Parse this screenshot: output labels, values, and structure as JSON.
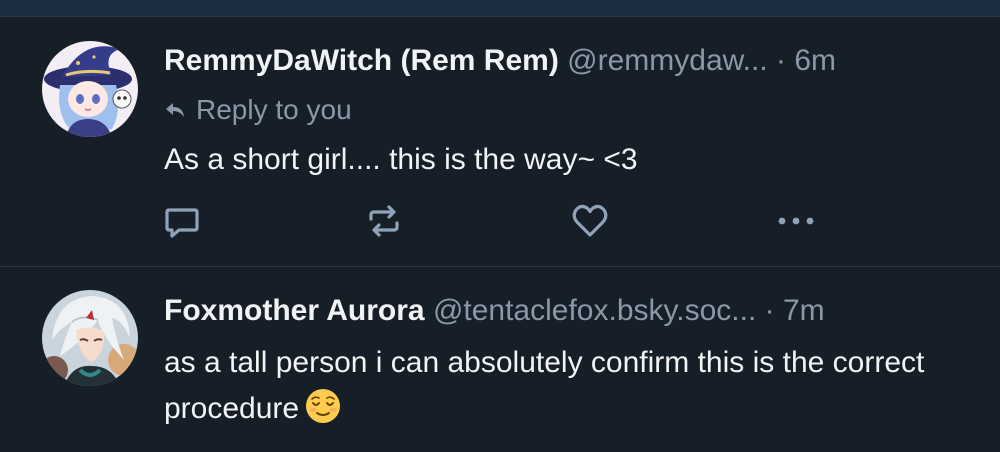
{
  "colors": {
    "background": "#161e27",
    "top_strip": "#1b2d40",
    "divider": "#2a3642",
    "text_primary": "#f1f3f5",
    "text_muted": "#8a98a8",
    "action_icon": "#8fa3b8"
  },
  "posts": [
    {
      "display_name": "RemmyDaWitch (Rem Rem)",
      "handle": "@remmydaw...",
      "separator": "·",
      "time": "6m",
      "reply_label": "Reply to you",
      "text": "As a short girl.... this is the way~ <3",
      "avatar_icon": "witch-avatar",
      "actions": [
        "reply-icon",
        "repost-icon",
        "like-icon",
        "more-icon"
      ]
    },
    {
      "display_name": "Foxmother Aurora",
      "handle": "@tentaclefox.bsky.soc...",
      "separator": "·",
      "time": "7m",
      "text": "as a tall person i can absolutely confirm this is the correct procedure",
      "emoji": "relieved-face-icon",
      "avatar_icon": "white-haired-character-avatar"
    }
  ]
}
